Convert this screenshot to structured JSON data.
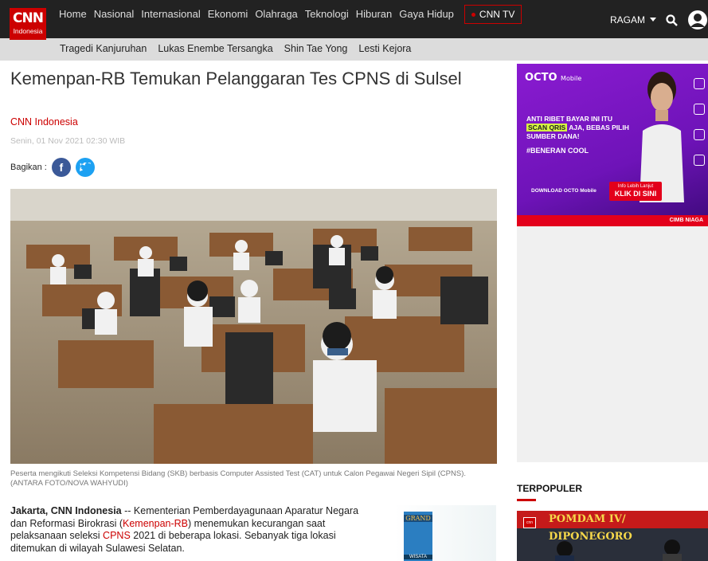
{
  "header": {
    "logo_text": "CNN",
    "logo_sub": "Indonesia",
    "nav": [
      "Home",
      "Nasional",
      "Internasional",
      "Ekonomi",
      "Olahraga",
      "Teknologi",
      "Hiburan",
      "Gaya Hidup"
    ],
    "cnntv_label": "CNN TV",
    "ragam_label": "RAGAM"
  },
  "trending": [
    "Tragedi Kanjuruhan",
    "Lukas Enembe Tersangka",
    "Shin Tae Yong",
    "Lesti Kejora"
  ],
  "article": {
    "title": "Kemenpan-RB Temukan Pelanggaran Tes CPNS di Sulsel",
    "source": "CNN Indonesia",
    "date": "Senin, 01 Nov 2021 02:30 WIB",
    "share_label": "Bagikan :",
    "caption": "Peserta mengikuti Seleksi Kompetensi Bidang (SKB) berbasis Computer Assisted Test (CAT) untuk Calon Pegawai Negeri Sipil (CPNS). (ANTARA FOTO/NOVA WAHYUDI)",
    "body_intro": "Jakarta, CNN Indonesia",
    "body_1": " -- Kementerian Pemberdayagunaan Aparatur Negara dan Reformasi Birokrasi (",
    "body_link1": "Kemenpan-RB",
    "body_2": ") menemukan kecurangan saat pelaksanaan seleksi ",
    "body_link2": "CPNS",
    "body_3": " 2021 di beberapa lokasi. Sebanyak tiga lokasi ditemukan di wilayah Sulawesi Selatan.",
    "mini_ad_top": "GRAND",
    "mini_ad_bottom": "WISATA"
  },
  "sidebar": {
    "ad_brand": "OCTO",
    "ad_brand_sub": "Mobile",
    "ad_line1": "ANTI RIBET BAYAR INI ITU",
    "ad_scan": "SCAN QRIS",
    "ad_line2": " AJA, BEBAS PILIH SUMBER DANA!",
    "ad_cool": "#BENERAN COOL",
    "ad_download": "DOWNLOAD OCTO Mobile",
    "ad_cta_small": "Info Lebih Lanjut",
    "ad_cta": "KLIK DI SINI",
    "ad_footer_brand": "CIMB NIAGA",
    "terpopuler_label": "TERPOPULER",
    "terpopuler_banner": "POMDAM IV/ DIPONEGORO",
    "terpopuler_badge": "cnn"
  }
}
